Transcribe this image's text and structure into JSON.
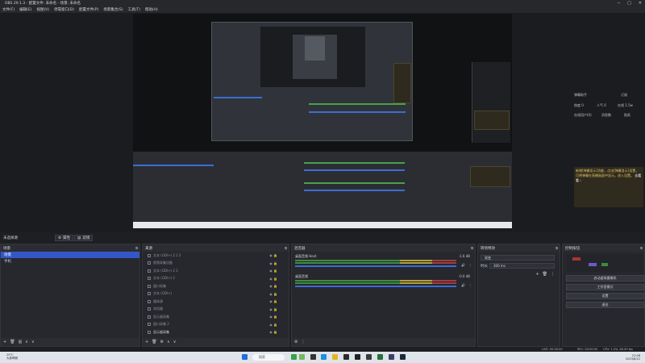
{
  "window": {
    "title": "OBS 29.1.3 - 配置文件: 未命名 - 场景: 未命名"
  },
  "menu": [
    "文件(F)",
    "编辑(E)",
    "视图(V)",
    "停靠窗口(D)",
    "配置文件(P)",
    "场景集合(S)",
    "工具(T)",
    "帮助(H)"
  ],
  "assistant": {
    "title": "弹幕助手",
    "subscribe": "订阅",
    "r1": [
      "热度 0",
      "人气 0",
      "在线 1.5w"
    ],
    "r2": [
      "在线用户(0)",
      "消息数",
      "贴纸"
    ],
    "yellow": "新增[弹幕显示]功能，点击[弹幕显示]设置，可将弹幕在直播画面中显示。进入设置。",
    "more": "去看看 ›"
  },
  "scene_toolbar": {
    "label": "未选择源",
    "props": "属性",
    "filters": "滤镜"
  },
  "scenes": {
    "title": "场景",
    "items": [
      "场景",
      "手机"
    ],
    "selected": 0
  },
  "sources": {
    "title": "来源",
    "items": [
      "文本 (GDI+) 2 2 2",
      "视频采集设备",
      "文本 (GDI+) 2 2",
      "文本 (GDI+) 2",
      "窗口采集",
      "文本 (GDI+)",
      "媒体源",
      "浏览器",
      "显示器采集",
      "窗口采集 2",
      "显示器采集"
    ]
  },
  "mixer": {
    "title": "混音器",
    "channels": [
      {
        "name": "桌面音频 Host",
        "db": "-1.6 dB"
      },
      {
        "name": "桌面音频",
        "db": "-0.0 dB"
      }
    ]
  },
  "transitions": {
    "title": "转场特效",
    "selected": "渐变",
    "duration_label": "时长",
    "duration": "300 ms"
  },
  "controls": {
    "title": "控制按钮",
    "buttons": [
      "启动虚拟摄像机",
      "工作室模式",
      "设置",
      "退出"
    ]
  },
  "status": {
    "live": "LIVE: 00:00:00",
    "rec": "REC: 00:00:00",
    "cpu": "CPU: 1.4%, 60.00 fps"
  },
  "taskbar": {
    "weather_temp": "29°C",
    "weather_desc": "大部晴朗",
    "search": "搜索",
    "time": "21:08",
    "date": "2023/8/12"
  },
  "colors": {
    "accent": "#3457c8",
    "panel": "#26282d",
    "meter_green": "#3f8c3f"
  }
}
